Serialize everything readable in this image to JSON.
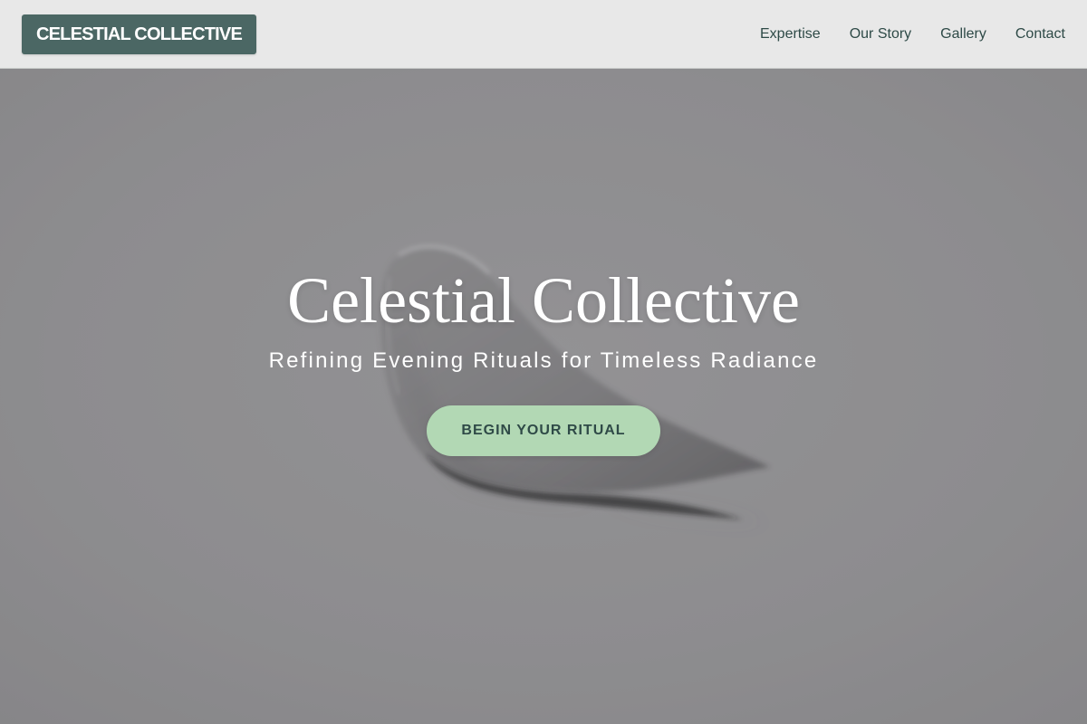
{
  "header": {
    "logo_text": "CELESTIAL COLLECTIVE",
    "nav": [
      {
        "label": "Expertise"
      },
      {
        "label": "Our Story"
      },
      {
        "label": "Gallery"
      },
      {
        "label": "Contact"
      }
    ]
  },
  "hero": {
    "title": "Celestial Collective",
    "subtitle": "Refining Evening Rituals for Timeless Radiance",
    "cta_label": "BEGIN YOUR RITUAL",
    "background_image": "gel-drop-on-spoon-photo"
  },
  "colors": {
    "header_bg": "#e8e8e8",
    "logo_bg": "#4b6764",
    "nav_text": "#2e4a47",
    "hero_overlay": "#8d8c8e",
    "cta_bg": "#b2d8b4",
    "cta_text": "#2f4a47"
  }
}
